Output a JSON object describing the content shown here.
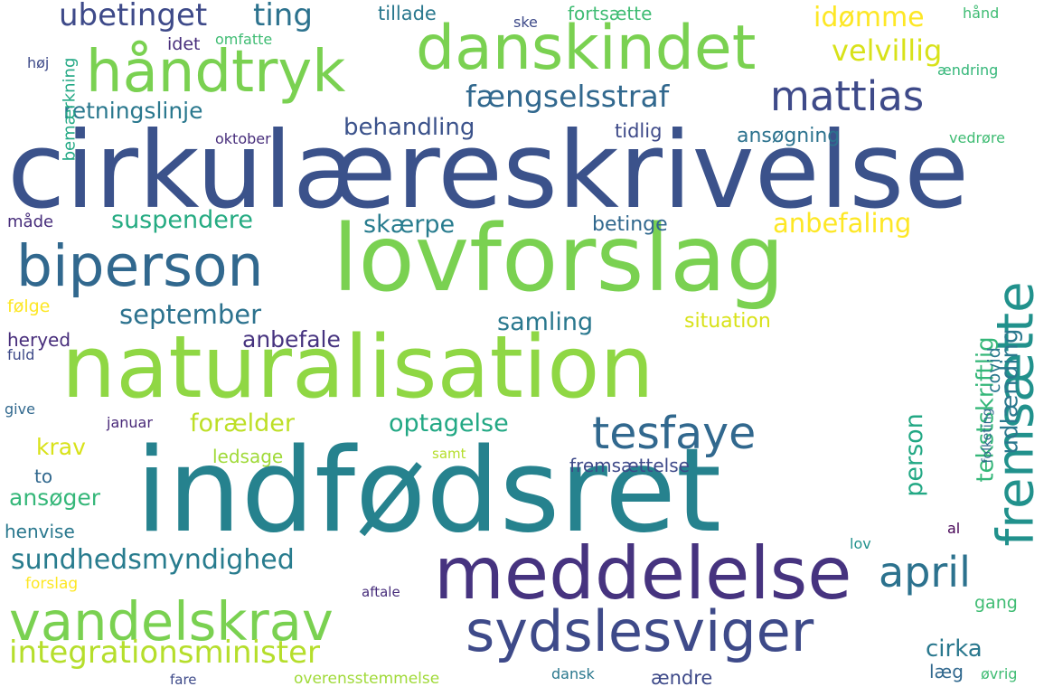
{
  "words": [
    {
      "text": "cirkulæreskrivelse",
      "color": "#3b528b"
    },
    {
      "text": "indfødsret",
      "color": "#26828e"
    },
    {
      "text": "lovforslag",
      "color": "#7ad151"
    },
    {
      "text": "naturalisation",
      "color": "#8fd744"
    },
    {
      "text": "meddelelse",
      "color": "#46337f"
    },
    {
      "text": "danskindet",
      "color": "#7ad151"
    },
    {
      "text": "håndtryk",
      "color": "#7ad151"
    },
    {
      "text": "biperson",
      "color": "#31688e"
    },
    {
      "text": "sydslesviger",
      "color": "#3e4a89"
    },
    {
      "text": "vandelskrav",
      "color": "#7ad151"
    },
    {
      "text": "fremsætte",
      "color": "#21918c"
    },
    {
      "text": "tesfaye",
      "color": "#31688e"
    },
    {
      "text": "mattias",
      "color": "#3e4a89"
    },
    {
      "text": "april",
      "color": "#2c728e"
    },
    {
      "text": "integrationsminister",
      "color": "#b5de2b"
    },
    {
      "text": "sundhedsmyndighed",
      "color": "#287c8e"
    },
    {
      "text": "fængselsstraf",
      "color": "#31688e"
    },
    {
      "text": "ubetinget",
      "color": "#3e4a89"
    },
    {
      "text": "ting",
      "color": "#2c728e"
    },
    {
      "text": "idømme",
      "color": "#fde725"
    },
    {
      "text": "velvillig",
      "color": "#d8e219"
    },
    {
      "text": "retningslinje",
      "color": "#2a788e"
    },
    {
      "text": "behandling",
      "color": "#3b528b"
    },
    {
      "text": "anbefaling",
      "color": "#fde725"
    },
    {
      "text": "suspendere",
      "color": "#25ab82"
    },
    {
      "text": "skærpe",
      "color": "#287c8e"
    },
    {
      "text": "september",
      "color": "#2c728e"
    },
    {
      "text": "samling",
      "color": "#2a788e"
    },
    {
      "text": "anbefale",
      "color": "#46337f"
    },
    {
      "text": "forælder",
      "color": "#bddf26"
    },
    {
      "text": "optagelse",
      "color": "#22a884"
    },
    {
      "text": "krav",
      "color": "#d8e219"
    },
    {
      "text": "ansøger",
      "color": "#35b779"
    },
    {
      "text": "person",
      "color": "#22a884"
    },
    {
      "text": "udlænding",
      "color": "#2a788e"
    },
    {
      "text": "tekstskriftlig",
      "color": "#35b779"
    },
    {
      "text": "covid",
      "color": "#2a788e"
    },
    {
      "text": "cirka",
      "color": "#2a788e"
    },
    {
      "text": "situation",
      "color": "#d8e219"
    },
    {
      "text": "betinge",
      "color": "#31688e"
    },
    {
      "text": "tidlig",
      "color": "#3e4a89"
    },
    {
      "text": "ansøgning",
      "color": "#2c728e"
    },
    {
      "text": "oktober",
      "color": "#472d7b"
    },
    {
      "text": "tillade",
      "color": "#2a788e"
    },
    {
      "text": "fortsætte",
      "color": "#3fbc73"
    },
    {
      "text": "ske",
      "color": "#3e4a89"
    },
    {
      "text": "hånd",
      "color": "#3fbc73"
    },
    {
      "text": "idet",
      "color": "#472d7b"
    },
    {
      "text": "omfatte",
      "color": "#3fbc73"
    },
    {
      "text": "høj",
      "color": "#3e4a89"
    },
    {
      "text": "ændring",
      "color": "#35b779"
    },
    {
      "text": "bemærkning",
      "color": "#22a884"
    },
    {
      "text": "vedrøre",
      "color": "#3fbc73"
    },
    {
      "text": "måde",
      "color": "#472d7b"
    },
    {
      "text": "følge",
      "color": "#fde725"
    },
    {
      "text": "heryed",
      "color": "#472d7b"
    },
    {
      "text": "fuld",
      "color": "#3e4a89"
    },
    {
      "text": "give",
      "color": "#31688e"
    },
    {
      "text": "januar",
      "color": "#482878"
    },
    {
      "text": "ledsage",
      "color": "#a0da39"
    },
    {
      "text": "samt",
      "color": "#b5de2b"
    },
    {
      "text": "fremsættelse",
      "color": "#3e4a89"
    },
    {
      "text": "folketing",
      "color": "#31688e"
    },
    {
      "text": "to",
      "color": "#31688e"
    },
    {
      "text": "henvise",
      "color": "#2a788e"
    },
    {
      "text": "al",
      "color": "#440154"
    },
    {
      "text": "lov",
      "color": "#21918c"
    },
    {
      "text": "forslag",
      "color": "#fde725"
    },
    {
      "text": "aftale",
      "color": "#472d7b"
    },
    {
      "text": "gang",
      "color": "#3fbc73"
    },
    {
      "text": "læg",
      "color": "#31688e"
    },
    {
      "text": "øvrig",
      "color": "#3fbc73"
    },
    {
      "text": "fare",
      "color": "#3e4a89"
    },
    {
      "text": "overensstemmelse",
      "color": "#a0da39"
    },
    {
      "text": "dansk",
      "color": "#2a788e"
    },
    {
      "text": "ændre",
      "color": "#3e4a89"
    }
  ]
}
